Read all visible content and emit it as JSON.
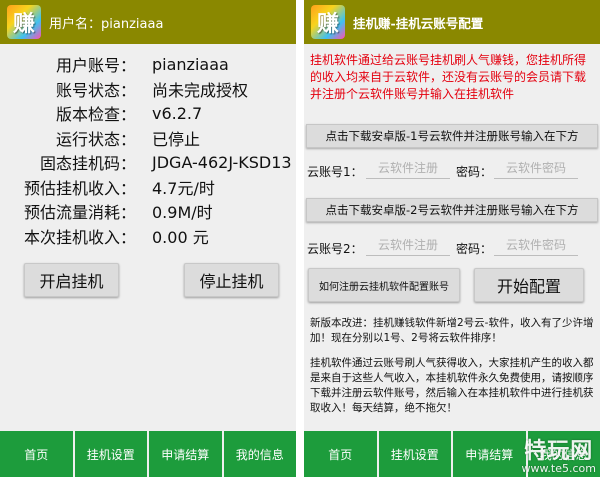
{
  "left_screen": {
    "app_bar": {
      "logo_char": "赚",
      "title": "用户名：pianziaaa"
    },
    "info_rows": [
      {
        "label": "用户账号：",
        "value": "pianziaaa"
      },
      {
        "label": "账号状态：",
        "value": "尚未完成授权"
      },
      {
        "label": "版本检查：",
        "value": "v6.2.7"
      },
      {
        "label": "运行状态：",
        "value": "已停止"
      },
      {
        "label": "固态挂机码：",
        "value": "JDGA-462J-KSD13"
      },
      {
        "label": "预估挂机收入：",
        "value": "4.7元/时"
      },
      {
        "label": "预估流量消耗：",
        "value": "0.9M/时"
      },
      {
        "label": "本次挂机收入：",
        "value": "0.00 元"
      }
    ],
    "start_button": "开启挂机",
    "stop_button": "停止挂机"
  },
  "right_screen": {
    "app_bar": {
      "logo_char": "赚",
      "title": "挂机赚-挂机云账号配置"
    },
    "notice": "挂机软件通过给云账号挂机刷人气赚钱，您挂机所得的收入均来自于云软件，还没有云账号的会员请下载并注册个云软件账号并输入在挂机软件",
    "download_button_1": "点击下载安卓版-1号云软件并注册账号输入在下方",
    "download_button_2": "点击下载安卓版-2号云软件并注册账号输入在下方",
    "account1": {
      "label": "云账号1：",
      "username_placeholder": "云软件注册",
      "password_label": "密码：",
      "password_placeholder": "云软件密码"
    },
    "account2": {
      "label": "云账号2：",
      "username_placeholder": "云软件注册",
      "password_label": "密码：",
      "password_placeholder": "云软件密码"
    },
    "how_to_button": "如何注册云挂机软件配置账号",
    "start_config_button": "开始配置",
    "update_text": "新版本改进：挂机赚钱软件新增2号云-软件，收入有了少许增加！现在分别以1号、2号将云软件排序！",
    "explain_text": "挂机软件通过云账号刷人气获得收入，大家挂机产生的收入都是来自于这些人气收入，本挂机软件永久免费使用，请按顺序下载并注册云软件账号，然后输入在本挂机软件中进行挂机获取收入！每天结算，绝不拖欠！"
  },
  "bottom_nav": {
    "items": [
      "首页",
      "挂机设置",
      "申请结算",
      "我的信息"
    ]
  },
  "watermark": {
    "main": "特玩网",
    "sub": "www.te5.com"
  },
  "colors": {
    "app_bar": "#8a8800",
    "nav_green": "#1d9c3c",
    "notice_red": "#e4000f",
    "screen_bg": "#efefef",
    "button_bg": "#dcdcdc"
  }
}
